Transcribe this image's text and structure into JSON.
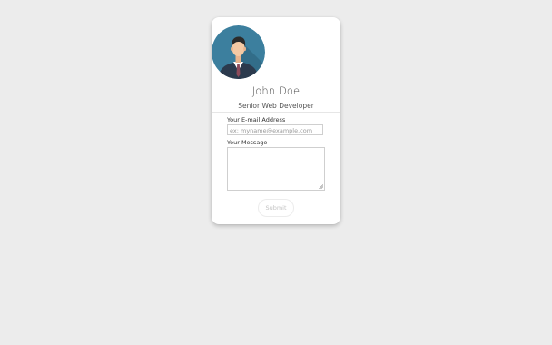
{
  "profile": {
    "name": "John Doe",
    "role": "Senior Web Developer"
  },
  "form": {
    "email_label": "Your E-mail Address",
    "email_placeholder": "ex: myname@example.com",
    "message_label": "Your Message",
    "message_value": "",
    "submit_label": "Submit"
  },
  "icons": {
    "avatar": "user-avatar-icon",
    "resize": "resize-handle-icon"
  },
  "colors": {
    "background": "#ececec",
    "card": "#ffffff",
    "avatar_bg": "#3c7f9e",
    "avatar_shadow": "#2f6782",
    "suit": "#2b3a4d",
    "tie": "#8c4a5a",
    "skin": "#f4c9a4",
    "hair": "#2b2b2b"
  }
}
